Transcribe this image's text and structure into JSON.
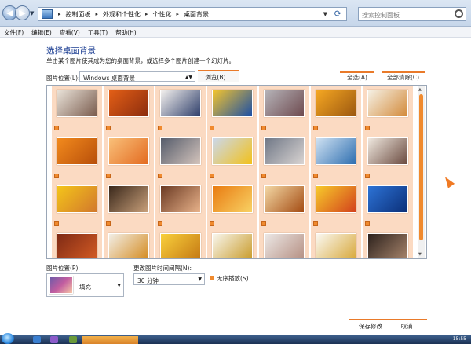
{
  "address": {
    "crumbs": [
      "控制面板",
      "外观和个性化",
      "个性化",
      "桌面背景"
    ],
    "search_placeholder": "搜索控制面板"
  },
  "menu": [
    "文件(F)",
    "编辑(E)",
    "查看(V)",
    "工具(T)",
    "帮助(H)"
  ],
  "page": {
    "heading": "选择桌面背景",
    "subtext": "单击某个图片使其成为您的桌面背景，或选择多个图片创建一个幻灯片。"
  },
  "location": {
    "label": "图片位置(L):",
    "selected": "Windows 桌面背景",
    "browse": "浏览(B)...",
    "select_all": "全选(A)",
    "clear_all": "全部清除(C)"
  },
  "thumbnails": [
    {
      "colors": [
        "#e9e2d8",
        "#7a5c4e"
      ]
    },
    {
      "colors": [
        "#e35f16",
        "#8b2c0e"
      ]
    },
    {
      "colors": [
        "#f4f1ee",
        "#2f3f6b"
      ]
    },
    {
      "colors": [
        "#f3c42e",
        "#1c4fa5"
      ]
    },
    {
      "colors": [
        "#b6b4b9",
        "#6e4a4f"
      ]
    },
    {
      "colors": [
        "#f5a722",
        "#9c5810"
      ]
    },
    {
      "colors": [
        "#f5f0e4",
        "#d38a3a"
      ]
    },
    {
      "colors": [
        "#f28a1d",
        "#b84f0a"
      ]
    },
    {
      "colors": [
        "#f9c07a",
        "#e36a1f"
      ]
    },
    {
      "colors": [
        "#555c6b",
        "#d4c4bc"
      ]
    },
    {
      "colors": [
        "#cbd8ec",
        "#f2c11b"
      ]
    },
    {
      "colors": [
        "#6f7786",
        "#d9d4d2"
      ]
    },
    {
      "colors": [
        "#cfe1f2",
        "#2f6fb0"
      ]
    },
    {
      "colors": [
        "#efe8df",
        "#6a4a3f"
      ]
    },
    {
      "colors": [
        "#f4c51a",
        "#d2782c"
      ]
    },
    {
      "colors": [
        "#3a281b",
        "#c9a07a"
      ]
    },
    {
      "colors": [
        "#6b3a23",
        "#e8b28a"
      ]
    },
    {
      "colors": [
        "#e97b11",
        "#f8d164"
      ]
    },
    {
      "colors": [
        "#f4d9a6",
        "#a44c13"
      ]
    },
    {
      "colors": [
        "#f7ca2b",
        "#d3421c"
      ]
    },
    {
      "colors": [
        "#2d73d6",
        "#0b2f78"
      ]
    },
    {
      "colors": [
        "#7f2a15",
        "#d35b24"
      ]
    },
    {
      "colors": [
        "#f2eee6",
        "#d48a1f"
      ]
    },
    {
      "colors": [
        "#f9d03c",
        "#c47813"
      ]
    },
    {
      "colors": [
        "#f8f6ee",
        "#c99b2a"
      ]
    },
    {
      "colors": [
        "#ece8e6",
        "#b58f82"
      ]
    },
    {
      "colors": [
        "#faf8f2",
        "#d8a83a"
      ]
    },
    {
      "colors": [
        "#2d221d",
        "#a8856c"
      ]
    }
  ],
  "position": {
    "label": "图片位置(P):",
    "value": "填充"
  },
  "interval": {
    "label": "更改图片时间间隔(N):",
    "value": "30 分钟"
  },
  "shuffle": {
    "label": "无序播放(S)",
    "checked": true
  },
  "buttons": {
    "save": "保存修改",
    "cancel": "取消"
  },
  "taskbar": {
    "time": "15:55"
  },
  "colors": {
    "accent": "#e97a2a",
    "selected_bg": "#fbdac2",
    "heading": "#1d3f93"
  }
}
